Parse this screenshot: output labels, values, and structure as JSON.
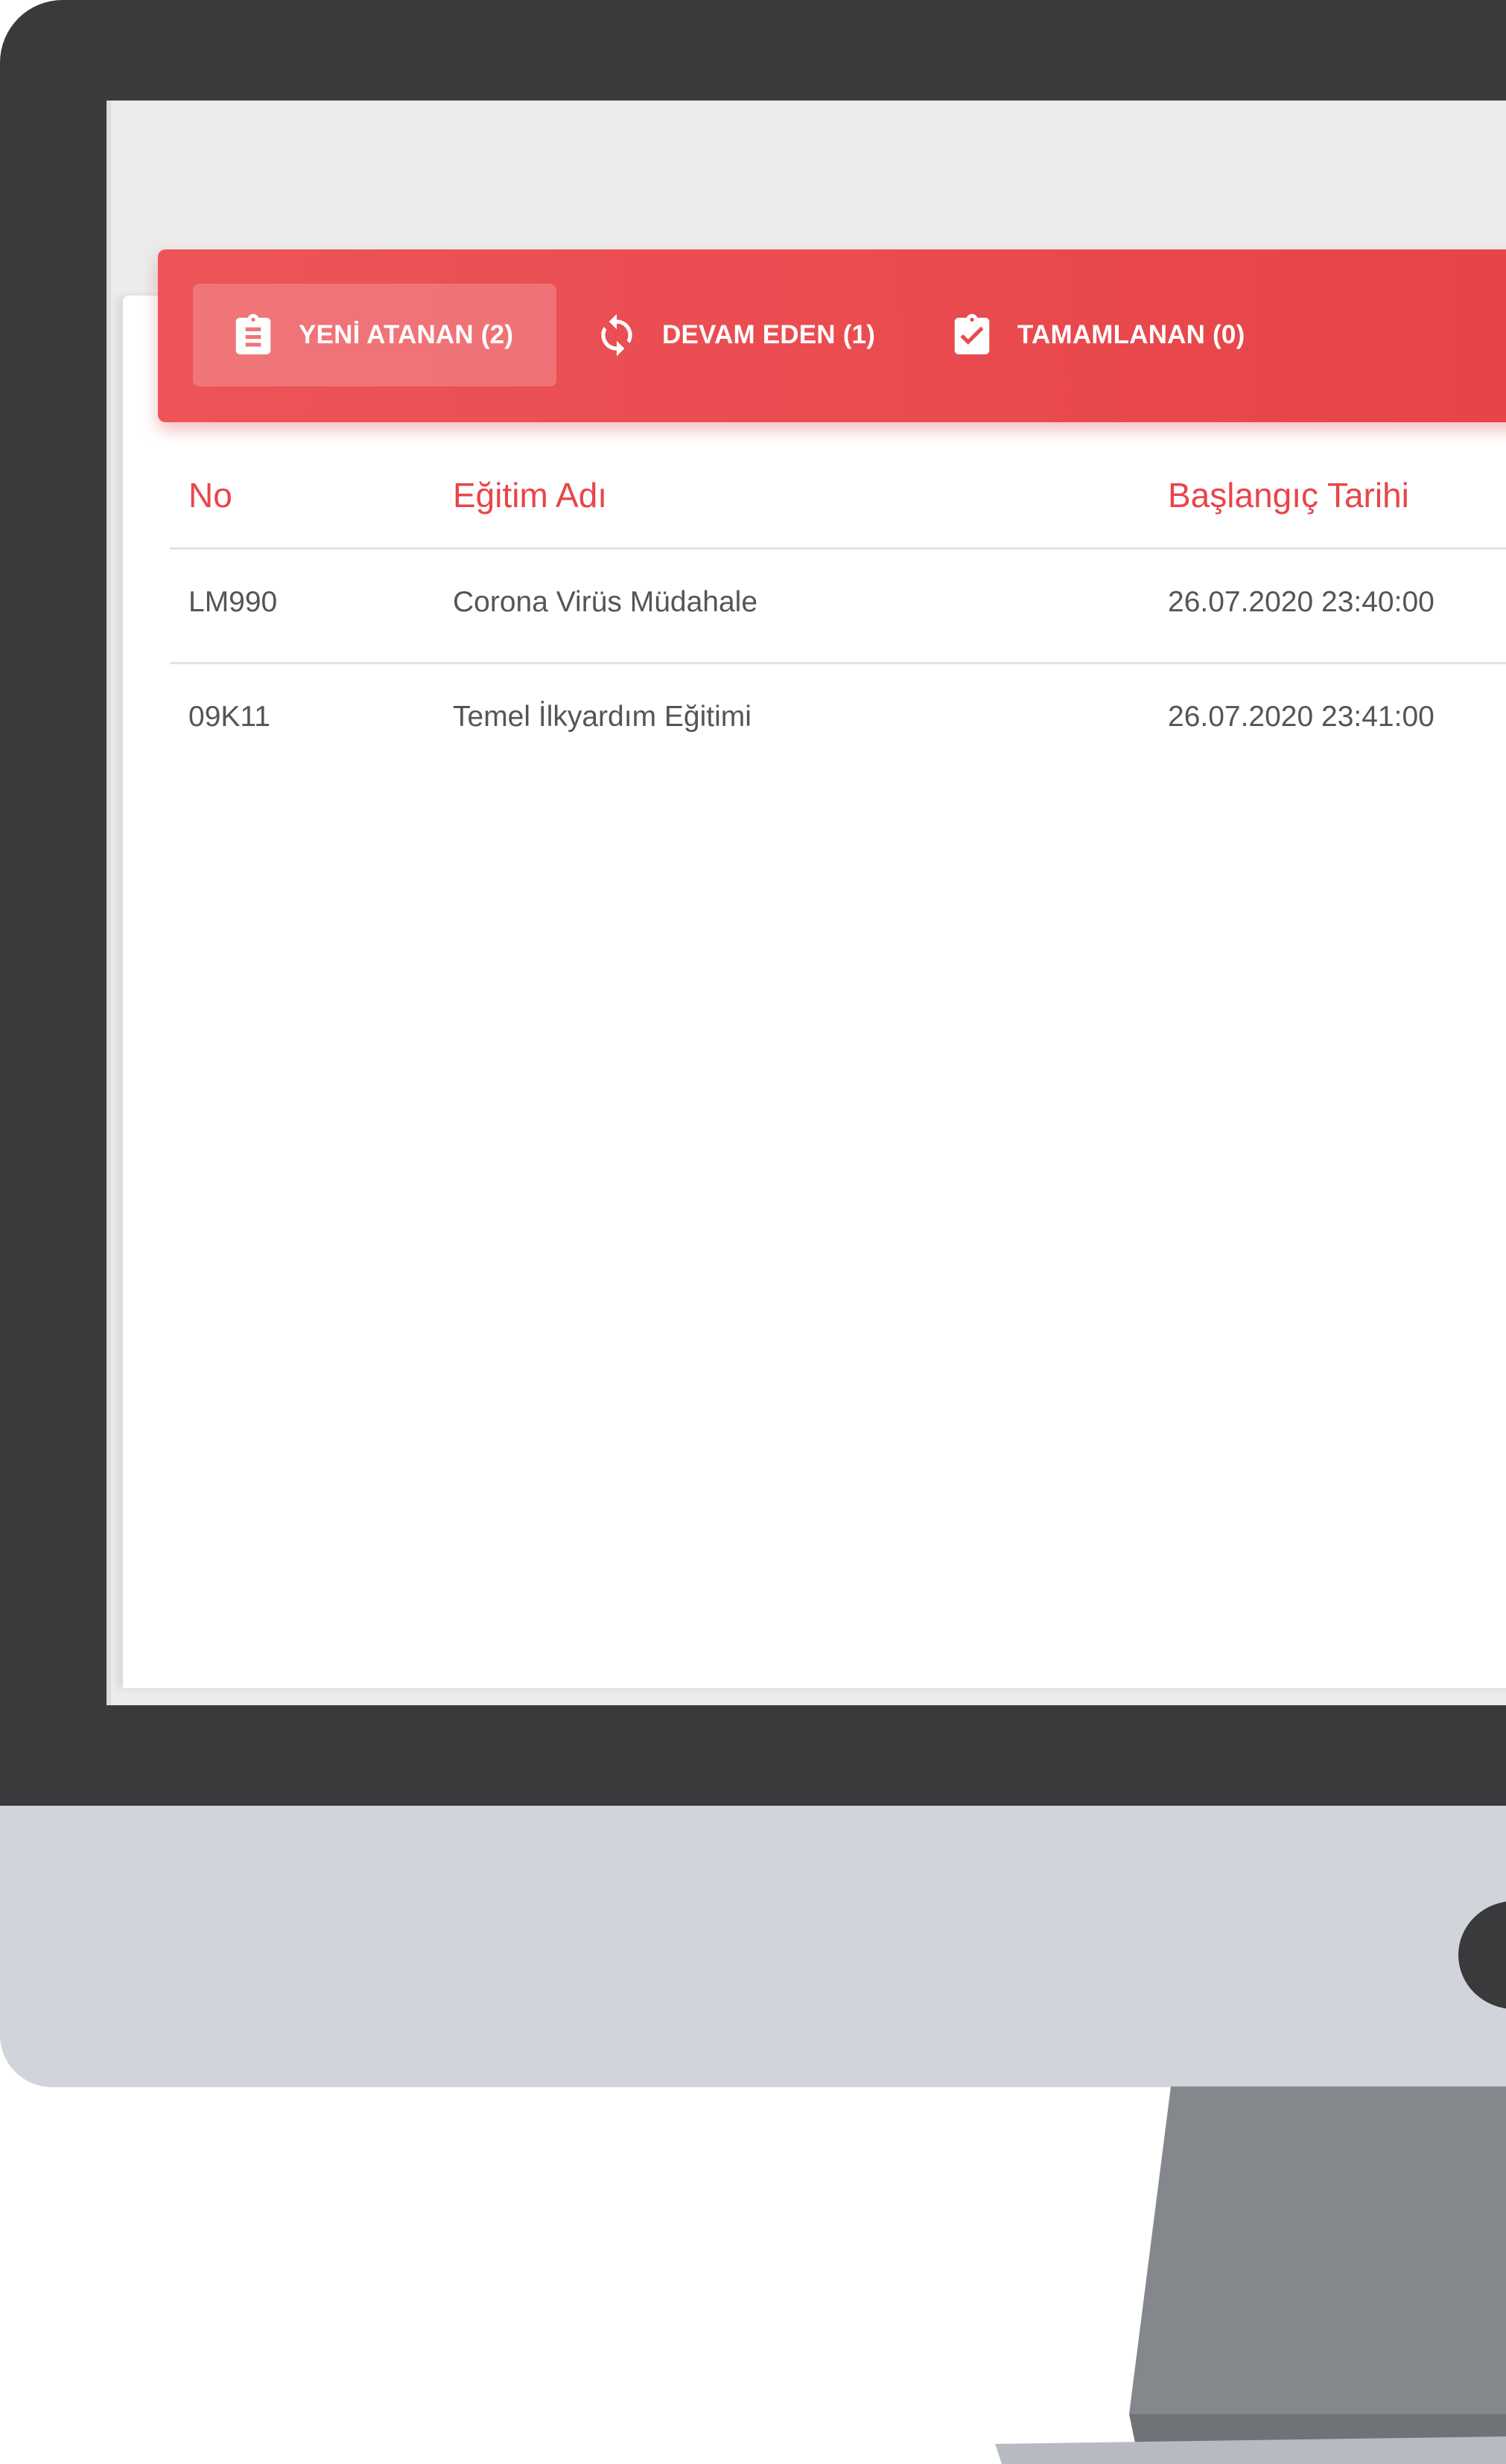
{
  "tabs": [
    {
      "label": "YENİ ATANAN (2)",
      "icon": "clipboard-list-icon",
      "active": true
    },
    {
      "label": "DEVAM EDEN (1)",
      "icon": "sync-icon",
      "active": false
    },
    {
      "label": "TAMAMLANAN (0)",
      "icon": "clipboard-check-icon",
      "active": false
    }
  ],
  "table": {
    "headers": {
      "no": "No",
      "name": "Eğitim Adı",
      "start": "Başlangıç Tarihi"
    },
    "rows": [
      {
        "no": "LM990",
        "name": "Corona Virüs Müdahale",
        "start": "26.07.2020 23:40:00"
      },
      {
        "no": "09K11",
        "name": "Temel İlkyardım Eğitimi",
        "start": "26.07.2020 23:41:00"
      }
    ]
  },
  "colors": {
    "accent": "#e8454a",
    "bezel": "#3a3a3c",
    "chin": "#d1d5db",
    "stand": "#84878c"
  }
}
